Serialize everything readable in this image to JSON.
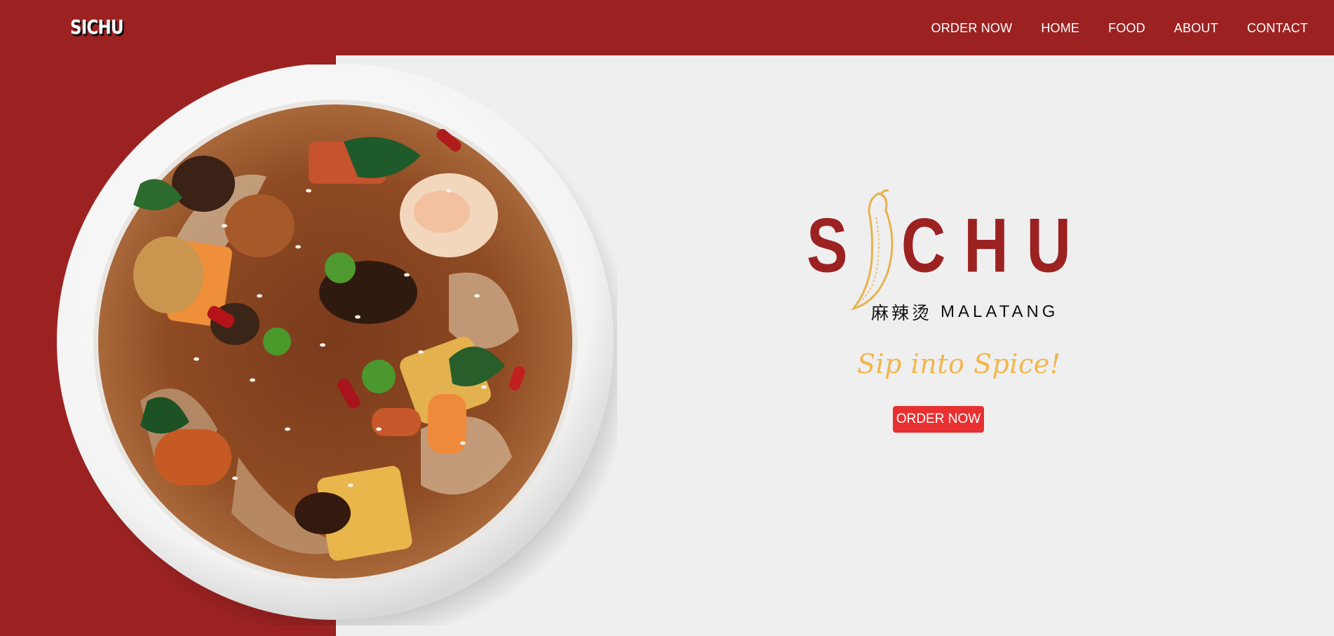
{
  "header": {
    "brand": "SICHU",
    "nav": [
      {
        "label": "ORDER NOW"
      },
      {
        "label": "HOME"
      },
      {
        "label": "FOOD"
      },
      {
        "label": "ABOUT"
      },
      {
        "label": "CONTACT"
      }
    ]
  },
  "hero": {
    "logo_letters": "S CHU",
    "logo_subtitle_cn": "麻辣烫",
    "logo_subtitle_en": "MALATANG",
    "tagline": "Sip into Spice!",
    "cta_label": "ORDER NOW",
    "image_subject": "bowl-of-malatang"
  },
  "colors": {
    "brand_red": "#9c2222",
    "page_bg": "#efefef",
    "tagline_gold": "#f2b64a",
    "cta_red": "#e83030"
  }
}
